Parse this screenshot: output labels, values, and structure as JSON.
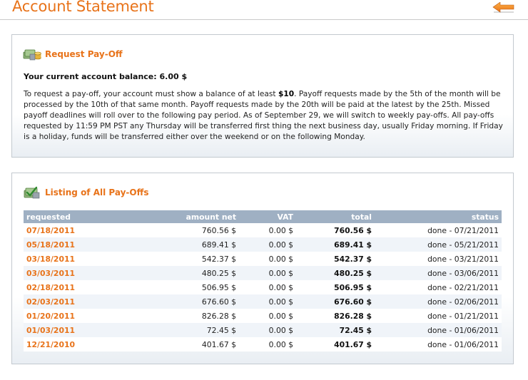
{
  "page": {
    "title": "Account Statement"
  },
  "icons": {
    "back": "back-arrow-icon",
    "payoff": "money-stack-icon",
    "listing": "money-check-icon"
  },
  "colors": {
    "accent": "#e8731a",
    "table_header": "#9fb0c3"
  },
  "request_panel": {
    "title": "Request Pay-Off",
    "balance": "Your current account balance: 6.00 $",
    "info_pre": "To request a pay-off, your account must show a balance of at least ",
    "info_min": "$10",
    "info_post": ". Payoff requests made by the 5th of the month will be processed by the 10th of that same month. Payoff requests made by the 20th will be paid at the latest by the 25th. Missed payoff deadlines will roll over to the following pay period. As of September 29, we will switch to weekly pay-offs. All pay-offs requested by 11:59 PM PST any Thursday will be transferred first thing the next business day, usually Friday morning. If Friday is a holiday, funds will be transferred either over the weekend or on the following Monday."
  },
  "payoffs_panel": {
    "title": "Listing of All Pay-Offs",
    "columns": [
      "requested",
      "amount net",
      "VAT",
      "total",
      "status"
    ],
    "rows": [
      {
        "requested": "07/18/2011",
        "net": "760.56 $",
        "vat": "0.00 $",
        "total": "760.56 $",
        "status": "done - 07/21/2011"
      },
      {
        "requested": "05/18/2011",
        "net": "689.41 $",
        "vat": "0.00 $",
        "total": "689.41 $",
        "status": "done - 05/21/2011"
      },
      {
        "requested": "03/18/2011",
        "net": "542.37 $",
        "vat": "0.00 $",
        "total": "542.37 $",
        "status": "done - 03/21/2011"
      },
      {
        "requested": "03/03/2011",
        "net": "480.25 $",
        "vat": "0.00 $",
        "total": "480.25 $",
        "status": "done - 03/06/2011"
      },
      {
        "requested": "02/18/2011",
        "net": "506.95 $",
        "vat": "0.00 $",
        "total": "506.95 $",
        "status": "done - 02/21/2011"
      },
      {
        "requested": "02/03/2011",
        "net": "676.60 $",
        "vat": "0.00 $",
        "total": "676.60 $",
        "status": "done - 02/06/2011"
      },
      {
        "requested": "01/20/2011",
        "net": "826.28 $",
        "vat": "0.00 $",
        "total": "826.28 $",
        "status": "done - 01/21/2011"
      },
      {
        "requested": "01/03/2011",
        "net": "72.45 $",
        "vat": "0.00 $",
        "total": "72.45 $",
        "status": "done - 01/06/2011"
      },
      {
        "requested": "12/21/2010",
        "net": "401.67 $",
        "vat": "0.00 $",
        "total": "401.67 $",
        "status": "done - 01/06/2011"
      }
    ]
  }
}
